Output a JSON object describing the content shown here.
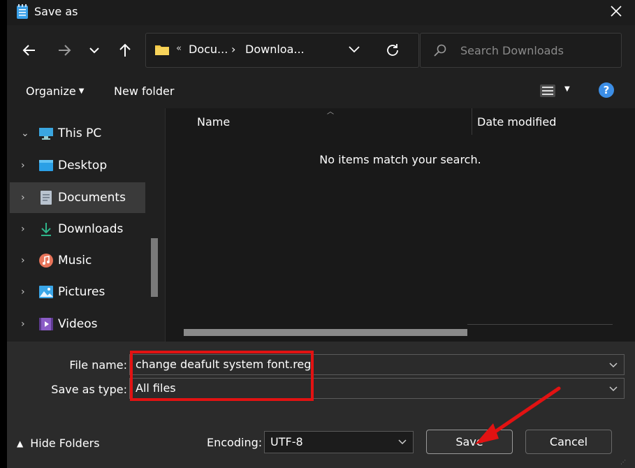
{
  "window": {
    "title": "Save as"
  },
  "address": {
    "crumb1": "Docu...",
    "crumb2": "Downloa...",
    "overflow": "«"
  },
  "search": {
    "placeholder": "Search Downloads"
  },
  "command_bar": {
    "organize": "Organize",
    "new_folder": "New folder",
    "help": "?"
  },
  "nav_tree": {
    "items": [
      {
        "label": "This PC",
        "icon": "pc-icon",
        "expanded": true
      },
      {
        "label": "Desktop",
        "icon": "desktop-icon"
      },
      {
        "label": "Documents",
        "icon": "documents-icon",
        "selected": true
      },
      {
        "label": "Downloads",
        "icon": "downloads-icon"
      },
      {
        "label": "Music",
        "icon": "music-icon"
      },
      {
        "label": "Pictures",
        "icon": "pictures-icon"
      },
      {
        "label": "Videos",
        "icon": "videos-icon"
      }
    ]
  },
  "file_list": {
    "columns": [
      "Name",
      "Date modified"
    ],
    "empty_message": "No items match your search."
  },
  "form": {
    "file_name_label": "File name:",
    "file_name_value": "change deafult system font.reg",
    "save_type_label": "Save as type:",
    "save_type_value": "All files",
    "encoding_label": "Encoding:",
    "encoding_value": "UTF-8"
  },
  "footer": {
    "hide_folders": "Hide Folders",
    "save": "Save",
    "cancel": "Cancel"
  },
  "colors": {
    "highlight": "#e21212",
    "accent": "#3c8ee6",
    "folder": "#f2c744"
  }
}
